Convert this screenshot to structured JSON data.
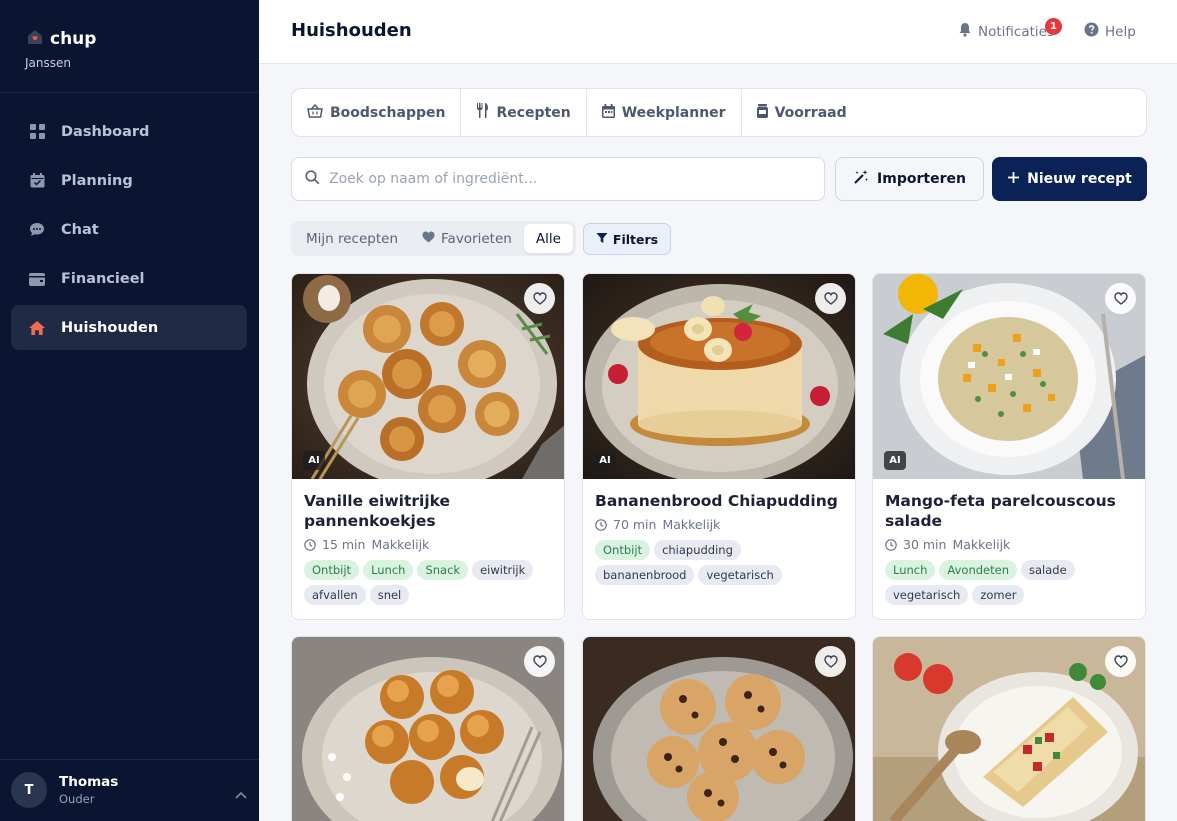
{
  "brand": {
    "name": "chup",
    "household": "Janssen"
  },
  "nav": {
    "items": [
      {
        "label": "Dashboard",
        "icon": "grid-icon"
      },
      {
        "label": "Planning",
        "icon": "calendar-icon"
      },
      {
        "label": "Chat",
        "icon": "chat-bubble-icon"
      },
      {
        "label": "Financieel",
        "icon": "wallet-icon"
      },
      {
        "label": "Huishouden",
        "icon": "home-icon",
        "active": true
      }
    ]
  },
  "user": {
    "initial": "T",
    "name": "Thomas",
    "role": "Ouder"
  },
  "header": {
    "title": "Huishouden",
    "notifications_label": "Notificaties",
    "notifications_count": "1",
    "help_label": "Help"
  },
  "tabs": [
    {
      "label": "Boodschappen",
      "icon": "basket-icon"
    },
    {
      "label": "Recepten",
      "icon": "utensils-icon"
    },
    {
      "label": "Weekplanner",
      "icon": "calendar-icon"
    },
    {
      "label": "Voorraad",
      "icon": "jar-icon"
    }
  ],
  "search": {
    "placeholder": "Zoek op naam of ingrediënt...",
    "value": ""
  },
  "actions": {
    "import_label": "Importeren",
    "new_label": "Nieuw recept"
  },
  "filter": {
    "segments": [
      {
        "label": "Mijn recepten",
        "active": false
      },
      {
        "label": "Favorieten",
        "active": false
      },
      {
        "label": "Alle",
        "active": true
      }
    ],
    "filters_label": "Filters"
  },
  "ai_badge": "AI",
  "recipes": [
    {
      "title": "Vanille eiwitrijke pannenkoekjes",
      "time": "15 min",
      "difficulty": "Makkelijk",
      "tags": [
        {
          "label": "Ontbijt",
          "kind": "green"
        },
        {
          "label": "Lunch",
          "kind": "green"
        },
        {
          "label": "Snack",
          "kind": "green"
        },
        {
          "label": "eiwitrijk",
          "kind": "gray"
        },
        {
          "label": "afvallen",
          "kind": "gray"
        },
        {
          "label": "snel",
          "kind": "gray"
        }
      ]
    },
    {
      "title": "Bananenbrood Chiapudding",
      "time": "70 min",
      "difficulty": "Makkelijk",
      "tags": [
        {
          "label": "Ontbijt",
          "kind": "green"
        },
        {
          "label": "chiapudding",
          "kind": "gray"
        },
        {
          "label": "bananenbrood",
          "kind": "gray"
        },
        {
          "label": "vegetarisch",
          "kind": "gray"
        }
      ]
    },
    {
      "title": "Mango-feta parelcouscous salade",
      "time": "30 min",
      "difficulty": "Makkelijk",
      "tags": [
        {
          "label": "Lunch",
          "kind": "green"
        },
        {
          "label": "Avondeten",
          "kind": "green"
        },
        {
          "label": "salade",
          "kind": "gray"
        },
        {
          "label": "vegetarisch",
          "kind": "gray"
        },
        {
          "label": "zomer",
          "kind": "gray"
        }
      ]
    }
  ],
  "colors": {
    "sidebar": "#0a1631",
    "accent": "#0b2256",
    "danger": "#e5383b",
    "tag_green": "#d9f2e1"
  }
}
